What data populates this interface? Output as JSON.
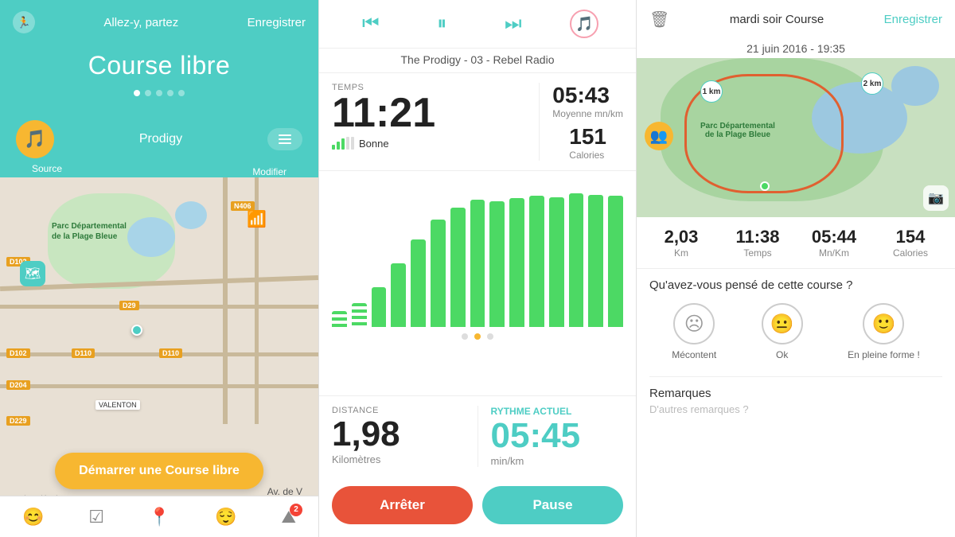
{
  "panel1": {
    "header": {
      "title": "Allez-y, partez",
      "enregistrer": "Enregistrer"
    },
    "course_title": "Course libre",
    "dots": [
      true,
      false,
      false,
      false,
      false
    ],
    "music": {
      "artist": "Prodigy",
      "source_label": "Source",
      "modifier_label": "Modifier"
    },
    "map": {
      "labels": [
        "D102",
        "D29",
        "D110",
        "D110",
        "D102",
        "D204",
        "D229",
        "N406"
      ],
      "green_area": "Parc Départemental de la Plage Bleue",
      "mentions": "Mentions légales"
    },
    "start_btn": "Démarrer une Course libre",
    "nav": {
      "items": [
        "😊",
        "☑",
        "📍",
        "😌",
        "⛰"
      ]
    }
  },
  "panel2": {
    "track": "The Prodigy - 03 - Rebel Radio",
    "stats": {
      "temps_label": "TEMPS",
      "time_value": "11:21",
      "quality_label": "Bonne",
      "moyenne_value": "05:43",
      "moyenne_label": "Moyenne mn/km",
      "calories_value": "151",
      "calories_label": "Calories"
    },
    "chart": {
      "bars": [
        20,
        30,
        50,
        70,
        110,
        130,
        150,
        160,
        155,
        158,
        162,
        165,
        163,
        168,
        165
      ]
    },
    "distance": {
      "label": "DISTANCE",
      "value": "1,98",
      "unit": "Kilomètres"
    },
    "rhythm": {
      "label": "RYTHME ACTUEL",
      "value": "05:45",
      "unit": "min/km"
    },
    "buttons": {
      "stop": "Arrêter",
      "pause": "Pause"
    }
  },
  "panel3": {
    "header": {
      "title": "mardi soir Course",
      "enregistrer": "Enregistrer"
    },
    "date": "21 juin 2016 - 19:35",
    "stats": {
      "distance": {
        "value": "2,03",
        "unit": "Km"
      },
      "time": {
        "value": "11:38",
        "unit": "Temps"
      },
      "pace": {
        "value": "05:44",
        "unit": "Mn/Km"
      },
      "calories": {
        "value": "154",
        "unit": "Calories"
      }
    },
    "feedback": {
      "title": "Qu'avez-vous pensé de cette course ?",
      "options": [
        {
          "label": "Mécontent",
          "emoji": "☹"
        },
        {
          "label": "Ok",
          "emoji": "😐"
        },
        {
          "label": "En pleine forme !",
          "emoji": "🙂"
        }
      ]
    },
    "remarks": {
      "title": "Remarques",
      "placeholder": "D'autres remarques ?"
    },
    "map": {
      "park_label": "Parc Départemental\nde la Plage Bleue",
      "km1": "1 km",
      "km2": "2 km"
    }
  }
}
